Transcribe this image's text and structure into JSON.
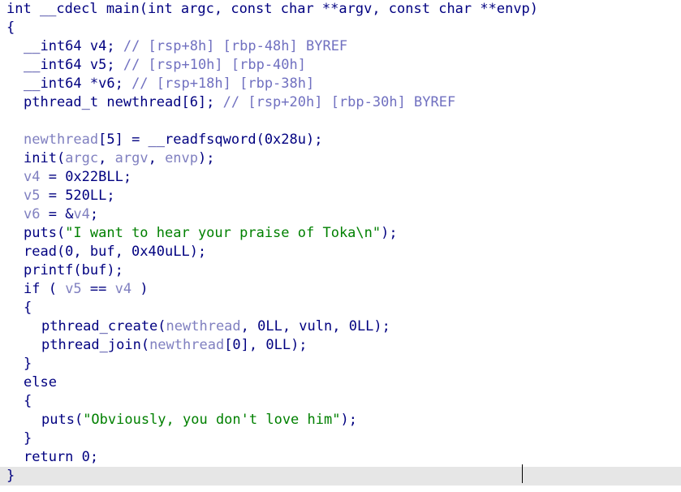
{
  "code": {
    "l1": [
      "int __cdecl main(int argc, const char **argv, const char **envp)"
    ],
    "l2": [
      "{"
    ],
    "l3": [
      "__int64 v4; ",
      "// [rsp+8h] [rbp-48h] BYREF"
    ],
    "l4": [
      "__int64 v5; ",
      "// [rsp+10h] [rbp-40h]"
    ],
    "l5": [
      "__int64 *v6; ",
      "// [rsp+18h] [rbp-38h]"
    ],
    "l6": [
      "pthread_t newthread[6]; ",
      "// [rsp+20h] [rbp-30h] BYREF"
    ],
    "l7": [
      ""
    ],
    "l8": [
      "newthread",
      "[5] = __readfsqword(0x28u);"
    ],
    "l9": [
      "init(",
      "argc",
      ", ",
      "argv",
      ", ",
      "envp",
      ");"
    ],
    "l10": [
      "v4",
      " = 0x22BLL;"
    ],
    "l11": [
      "v5",
      " = 520LL;"
    ],
    "l12": [
      "v6",
      " = &",
      "v4",
      ";"
    ],
    "l13": [
      "puts(",
      "\"I want to hear your praise of Toka\\n\"",
      ");"
    ],
    "l14": [
      "read(0, buf, 0x40uLL);"
    ],
    "l15": [
      "printf(buf);"
    ],
    "l16": [
      "if ( ",
      "v5",
      " == ",
      "v4",
      " )"
    ],
    "l17": [
      "{"
    ],
    "l18": [
      "pthread_create(",
      "newthread",
      ", 0LL, vuln, 0LL);"
    ],
    "l19": [
      "pthread_join(",
      "newthread",
      "[0], 0LL);"
    ],
    "l20": [
      "}"
    ],
    "l21": [
      "else"
    ],
    "l22": [
      "{"
    ],
    "l23": [
      "puts(",
      "\"Obviously, you don't love him\"",
      ");"
    ],
    "l24": [
      "}"
    ],
    "l25": [
      "return 0;"
    ],
    "l26": [
      "}"
    ]
  },
  "colors": {
    "text": "#000080",
    "comment": "#7070c0",
    "variable": "#8080c0",
    "string": "#008000",
    "current_line": "#e6e6e6"
  }
}
